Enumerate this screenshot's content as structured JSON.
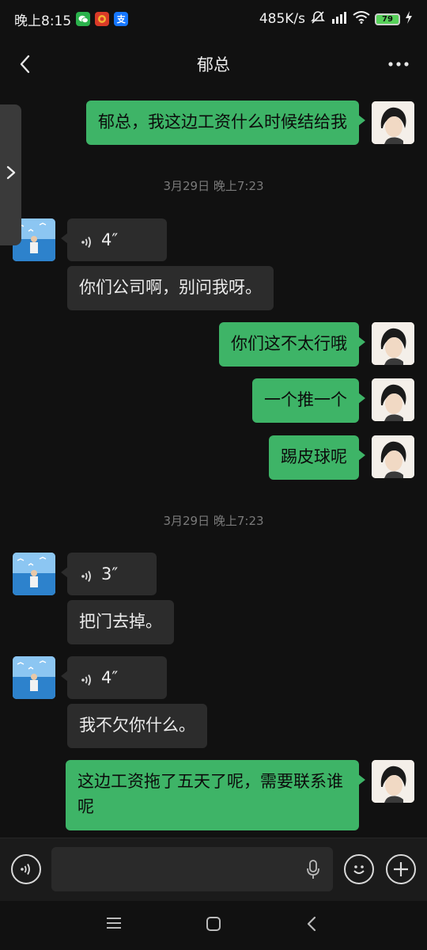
{
  "status": {
    "time": "晚上8:15",
    "icons": [
      "wechat-icon",
      "red-app-icon",
      "alipay-icon"
    ],
    "alipay_char": "支",
    "net_speed": "485K/s",
    "battery": "79"
  },
  "header": {
    "title": "郁总"
  },
  "messages": [
    {
      "type": "text",
      "from": "me",
      "text": "郁总，我这边工资什么时候结给我"
    },
    {
      "type": "time",
      "text": "3月29日 晚上7:23"
    },
    {
      "type": "voice",
      "from": "other",
      "duration": "4″"
    },
    {
      "type": "text",
      "from": "other",
      "text": "你们公司啊，别问我呀。"
    },
    {
      "type": "text",
      "from": "me",
      "text": "你们这不太行哦"
    },
    {
      "type": "text",
      "from": "me",
      "text": "一个推一个"
    },
    {
      "type": "text",
      "from": "me",
      "text": "踢皮球呢"
    },
    {
      "type": "time",
      "text": "3月29日 晚上7:23"
    },
    {
      "type": "voice",
      "from": "other",
      "duration": "3″"
    },
    {
      "type": "text",
      "from": "other",
      "text": "把门去掉。"
    },
    {
      "type": "voice",
      "from": "other",
      "duration": "4″"
    },
    {
      "type": "text",
      "from": "other",
      "text": "我不欠你什么。"
    },
    {
      "type": "text",
      "from": "me",
      "text": "这边工资拖了五天了呢，需要联系谁呢"
    }
  ],
  "colors": {
    "background": "#111111",
    "my_bubble": "#3eb467",
    "other_bubble": "#2c2c2c",
    "timestamp": "#7a7a7a"
  },
  "input": {
    "placeholder": ""
  }
}
